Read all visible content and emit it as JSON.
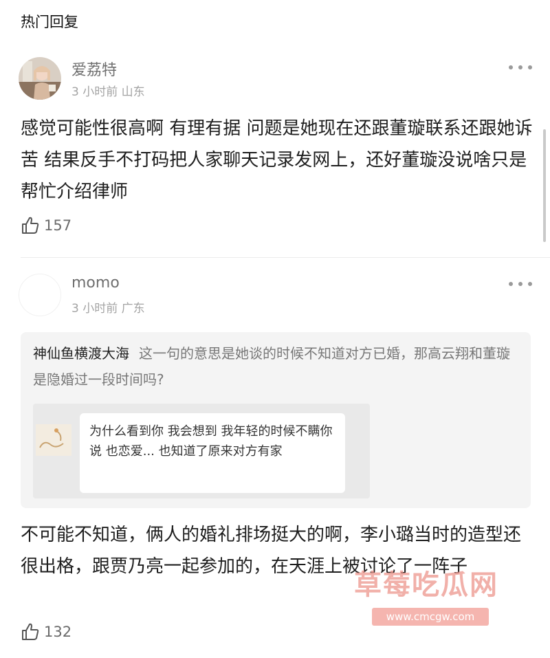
{
  "header": {
    "title": "热门回复"
  },
  "comments": [
    {
      "username": "爱荔特",
      "meta": "3 小时前  山东",
      "text": "感觉可能性很高啊 有理有据 问题是她现在还跟董璇联系还跟她诉苦 结果反手不打码把人家聊天记录发网上，还好董璇没说啥只是帮忙介绍律师",
      "likes": "157"
    },
    {
      "username": "momo",
      "meta": "3 小时前  广东",
      "quote": {
        "author": "神仙鱼横渡大海",
        "text": "这一句的意思是她谈的时候不知道对方已婚，那高云翔和董璇是隐婚过一段时间吗?",
        "bubble": "为什么看到你 我会想到 我年轻的时候不瞒你说 也恋爱... 也知道了原来对方有家"
      },
      "text": "不可能不知道，俩人的婚礼排场挺大的啊，李小璐当时的造型还很出格，跟贾乃亮一起参加的，在天涯上被讨论了一阵子",
      "likes": "132"
    }
  ],
  "watermark": {
    "title": "草莓吃瓜网",
    "url": "www.cmcgw.com"
  },
  "colors": {
    "text": "#1d1d1d",
    "meta": "#a3a3a3",
    "quote_bg": "#f4f4f4",
    "watermark": "#ec968c"
  },
  "icons": {
    "like": "thumbs-up-icon",
    "more": "more-dots-icon"
  }
}
